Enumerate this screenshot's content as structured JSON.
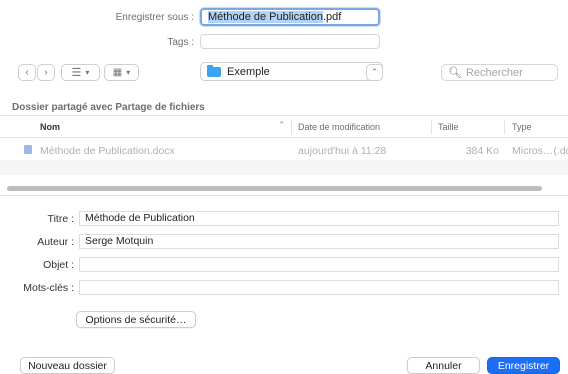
{
  "save_as": {
    "label": "Enregistrer sous :",
    "name_selected": "Méthode de Publication",
    "extension": ".pdf"
  },
  "tags": {
    "label": "Tags :",
    "value": ""
  },
  "toolbar": {
    "location": "Exemple",
    "search_placeholder": "Rechercher"
  },
  "location_header": "Dossier partagé avec Partage de fichiers",
  "columns": {
    "name": "Nom",
    "date": "Date de modification",
    "size": "Taille",
    "type": "Type"
  },
  "files": [
    {
      "name": "Méthode de Publication.docx",
      "date": "aujourd'hui à 11:28",
      "size": "384 Ko",
      "type": "Micros…(.do"
    }
  ],
  "metadata": {
    "title_label": "Titre :",
    "title_value": "Méthode de Publication",
    "author_label": "Auteur :",
    "author_value": "Serge Motquin",
    "subject_label": "Objet :",
    "subject_value": "",
    "keywords_label": "Mots-clés :",
    "keywords_value": ""
  },
  "security_button": "Options de sécurité…",
  "footer": {
    "new_folder": "Nouveau dossier",
    "cancel": "Annuler",
    "save": "Enregistrer"
  },
  "colors": {
    "accent": "#1c6ff5",
    "folder": "#3ea3ee",
    "selection": "#b3d2f7"
  }
}
